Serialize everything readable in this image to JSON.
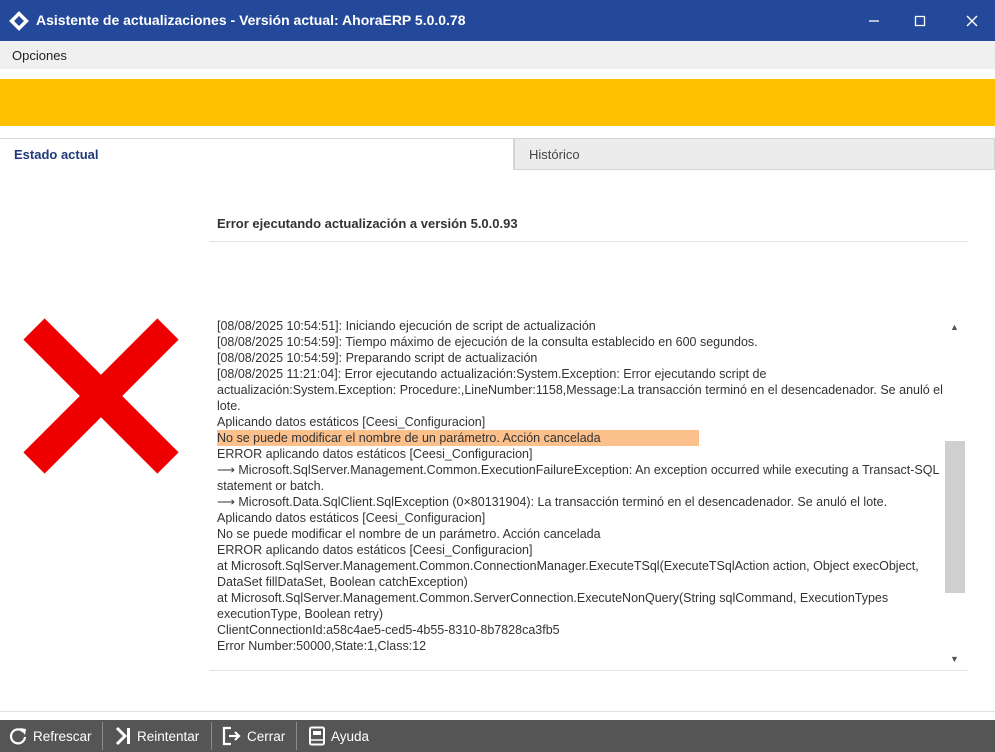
{
  "window": {
    "title": "Asistente de actualizaciones - Versión actual: AhoraERP 5.0.0.78",
    "title_bar_color": "#24489a",
    "controls": [
      "minimize-icon",
      "maximize-icon",
      "close-icon"
    ]
  },
  "menu": {
    "items": [
      {
        "label": "Opciones"
      }
    ]
  },
  "banner": {
    "color": "#ffc000"
  },
  "tabs": [
    {
      "label": "Estado actual",
      "active": true
    },
    {
      "label": "Histórico",
      "active": false
    }
  ],
  "status": {
    "title": "Error ejecutando actualización a versión 5.0.0.93",
    "icon": "error-x-icon",
    "icon_color": "#ee0000"
  },
  "log": {
    "highlight_color": "#fbc08c",
    "lines": [
      "[08/08/2025 10:54:51]: Iniciando ejecución de script de actualización",
      "[08/08/2025 10:54:59]: Tiempo máximo de ejecución de la consulta establecido en 600 segundos.",
      "[08/08/2025 10:54:59]: Preparando script de actualización",
      "[08/08/2025 11:21:04]: Error ejecutando actualización:System.Exception: Error ejecutando script de actualización:System.Exception: Procedure:,LineNumber:1158,Message:La transacción terminó en el desencadenador. Se anuló el lote.",
      "Aplicando datos estáticos [Ceesi_Configuracion]",
      "No se puede modificar el nombre de un parámetro. Acción cancelada",
      "ERROR aplicando datos estáticos [Ceesi_Configuracion]",
      "   ⟶ Microsoft.SqlServer.Management.Common.ExecutionFailureException: An exception occurred while executing a Transact-SQL statement or batch.",
      "   ⟶ Microsoft.Data.SqlClient.SqlException (0×80131904): La transacción terminó en el desencadenador. Se anuló el lote.",
      "Aplicando datos estáticos [Ceesi_Configuracion]",
      "No se puede modificar el nombre de un parámetro. Acción cancelada",
      "ERROR aplicando datos estáticos [Ceesi_Configuracion]",
      "   at Microsoft.SqlServer.Management.Common.ConnectionManager.ExecuteTSql(ExecuteTSqlAction action, Object execObject, DataSet fillDataSet, Boolean catchException)",
      "   at Microsoft.SqlServer.Management.Common.ServerConnection.ExecuteNonQuery(String sqlCommand, ExecutionTypes executionType, Boolean retry)",
      "ClientConnectionId:a58c4ae5-ced5-4b55-8310-8b7828ca3fb5",
      "Error Number:50000,State:1,Class:12"
    ]
  },
  "toolbar": {
    "buttons": [
      {
        "label": "Refrescar",
        "icon": "refresh-icon"
      },
      {
        "label": "Reintentar",
        "icon": "retry-icon"
      },
      {
        "label": "Cerrar",
        "icon": "exit-icon"
      },
      {
        "label": "Ayuda",
        "icon": "help-book-icon"
      }
    ]
  }
}
